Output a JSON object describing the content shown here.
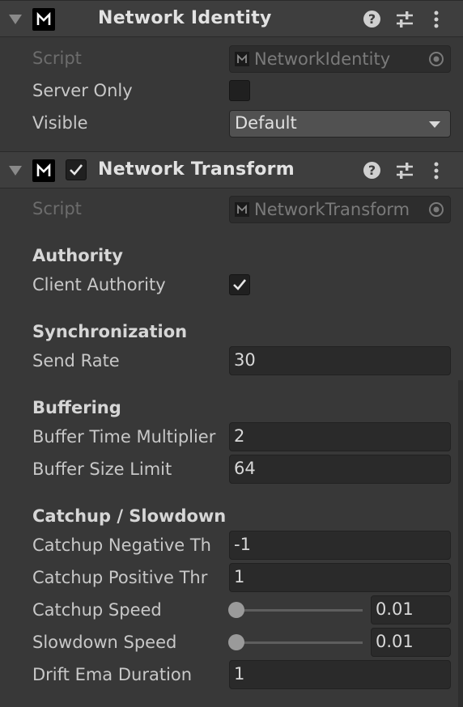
{
  "network_identity": {
    "title": "Network Identity",
    "script_label": "Script",
    "script_value": "NetworkIdentity",
    "server_only_label": "Server Only",
    "server_only_checked": false,
    "visible_label": "Visible",
    "visible_value": "Default"
  },
  "network_transform": {
    "title": "Network Transform",
    "enabled": true,
    "script_label": "Script",
    "script_value": "NetworkTransform",
    "authority": {
      "header": "Authority",
      "client_authority_label": "Client Authority",
      "client_authority_checked": true
    },
    "synchronization": {
      "header": "Synchronization",
      "send_rate_label": "Send Rate",
      "send_rate_value": "30"
    },
    "buffering": {
      "header": "Buffering",
      "buffer_time_multiplier_label": "Buffer Time Multiplier",
      "buffer_time_multiplier_value": "2",
      "buffer_size_limit_label": "Buffer Size Limit",
      "buffer_size_limit_value": "64"
    },
    "catchup": {
      "header": "Catchup / Slowdown",
      "catchup_negative_label": "Catchup Negative Th",
      "catchup_negative_value": "-1",
      "catchup_positive_label": "Catchup Positive Thr",
      "catchup_positive_value": "1",
      "catchup_speed_label": "Catchup Speed",
      "catchup_speed_value": "0.01",
      "catchup_speed_slider_fraction": 0.0,
      "slowdown_speed_label": "Slowdown Speed",
      "slowdown_speed_value": "0.01",
      "slowdown_speed_slider_fraction": 0.0,
      "drift_ema_duration_label": "Drift Ema Duration",
      "drift_ema_duration_value": "1"
    }
  },
  "icons": {
    "foldout": "foldout-arrow-icon",
    "script": "mirror-script-icon",
    "help": "help-icon",
    "presets": "presets-icon",
    "menu": "kebab-menu-icon",
    "object_picker": "object-picker-icon",
    "checkmark": "checkmark-icon",
    "dropdown": "dropdown-arrow-icon"
  },
  "colors": {
    "background": "#383838",
    "header_background": "#3e3e3e",
    "field_background": "#2a2a2a",
    "dropdown_background": "#515151",
    "text": "#c8c8c8",
    "disabled_text": "#6c6c6c"
  }
}
